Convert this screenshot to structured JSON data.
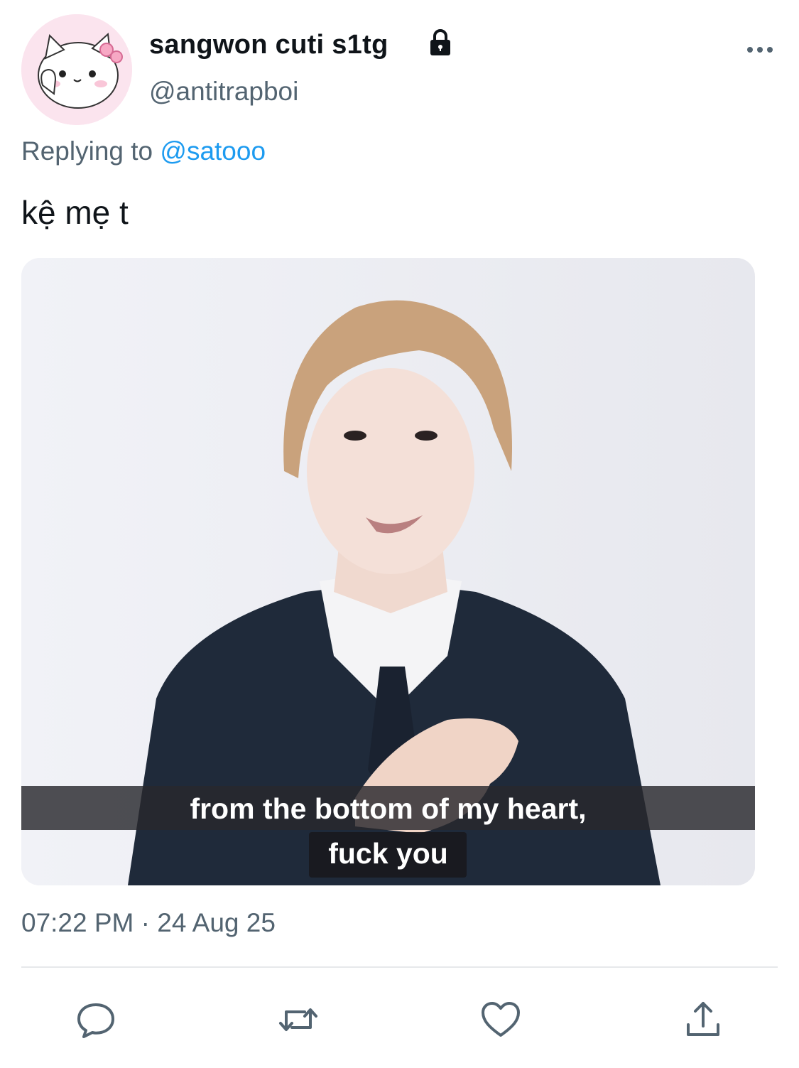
{
  "tweet": {
    "display_name": "sangwon cuti s1tg",
    "handle": "@antitrapboi",
    "protected_icon": "lock-icon",
    "more_icon": "more-horizontal-icon",
    "reply_prefix": "Replying to",
    "reply_to": "@satooo",
    "text": "kệ mẹ t",
    "media": {
      "subtitle_line1": "from the bottom of my heart,",
      "subtitle_line2": "fuck you"
    },
    "timestamp": "07:22 PM · 24 Aug 25"
  },
  "actions": [
    {
      "name": "reply",
      "icon": "speech-bubble-icon"
    },
    {
      "name": "retweet",
      "icon": "retweet-arrows-icon"
    },
    {
      "name": "like",
      "icon": "heart-icon"
    },
    {
      "name": "share",
      "icon": "share-upload-icon"
    }
  ],
  "colors": {
    "text_primary": "#0f1419",
    "text_secondary": "#536471",
    "link": "#1d9bf0",
    "divider": "#e6e8eb",
    "icon": "#536471"
  }
}
